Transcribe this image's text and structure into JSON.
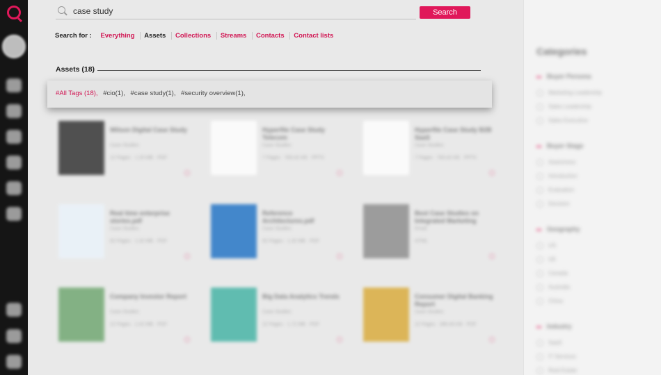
{
  "colors": {
    "accent": "#e0185a",
    "rail": "#151515"
  },
  "search": {
    "value": "case study",
    "button_label": "Search"
  },
  "search_for": {
    "label": "Search for :",
    "tabs": [
      {
        "label": "Everything",
        "active": false
      },
      {
        "label": "Assets",
        "active": true
      },
      {
        "label": "Collections",
        "active": false
      },
      {
        "label": "Streams",
        "active": false
      },
      {
        "label": "Contacts",
        "active": false
      },
      {
        "label": "Contact lists",
        "active": false
      }
    ]
  },
  "results": {
    "heading": "Assets (18)"
  },
  "tags": [
    {
      "label": "#All Tags (18),"
    },
    {
      "label": "#cio(1),"
    },
    {
      "label": "#case study(1),"
    },
    {
      "label": "#security overview(1),"
    }
  ],
  "rail_icons": [
    "logo-icon",
    "avatar",
    "eye-icon",
    "layers-icon",
    "stream-icon",
    "contacts-icon",
    "globe-icon",
    "rocket-icon",
    "chat-icon",
    "list-icon",
    "logout-icon"
  ],
  "categories": {
    "title": "Categories",
    "groups": [
      {
        "name": "Buyer Persona",
        "options": [
          "Marketing Leadership",
          "Sales Leadership",
          "Sales Executive"
        ]
      },
      {
        "name": "Buyer Stage",
        "options": [
          "Awareness",
          "Introduction",
          "Evaluation",
          "Decision"
        ]
      },
      {
        "name": "Geography",
        "options": [
          "US",
          "UK",
          "Canada",
          "Australia",
          "China"
        ]
      },
      {
        "name": "Industry",
        "options": [
          "SaaS",
          "IT Services",
          "Real Estate"
        ]
      }
    ]
  },
  "assets": [
    {
      "title": "Wilson Digital Case Study",
      "type": "Case Studies",
      "meta": "12 Pages · 1.25 MB · PDF",
      "thumb": "#2b2b2b"
    },
    {
      "title": "Hyperfile Case Study Telecom",
      "type": "Case Studies",
      "meta": "7 Pages · 783.42 KB · PPTX",
      "thumb": "#ffffff"
    },
    {
      "title": "Hyperfile Case Study B2B SaaS",
      "type": "Case Studies",
      "meta": "7 Pages · 783.42 KB · PPTX",
      "thumb": "#ffffff"
    },
    {
      "title": "Real time enterprise stories.pdf",
      "type": "Case Studies",
      "meta": "62 Pages · 1.32 MB · PDF",
      "thumb": "#eaf3fb"
    },
    {
      "title": "Reference Architectures.pdf",
      "type": "Case Studies",
      "meta": "62 Pages · 1.32 MB · PDF",
      "thumb": "#1a6fc4"
    },
    {
      "title": "Best Case Studies on Integrated Marketing",
      "type": "Email",
      "meta": "HTML",
      "thumb": "#8a8a8a"
    },
    {
      "title": "Company Investor Report",
      "type": "Case Studies",
      "meta": "22 Pages · 2.42 MB · PDF",
      "thumb": "#6aa46b"
    },
    {
      "title": "Big Data Analytics Trends",
      "type": "Case Studies",
      "meta": "22 Pages · 1.72 MB · PDF",
      "thumb": "#3fb2a3"
    },
    {
      "title": "Consumer Digital Banking Report",
      "type": "Case Studies",
      "meta": "22 Pages · 386.46 KB · PDF",
      "thumb": "#d9a934"
    }
  ]
}
